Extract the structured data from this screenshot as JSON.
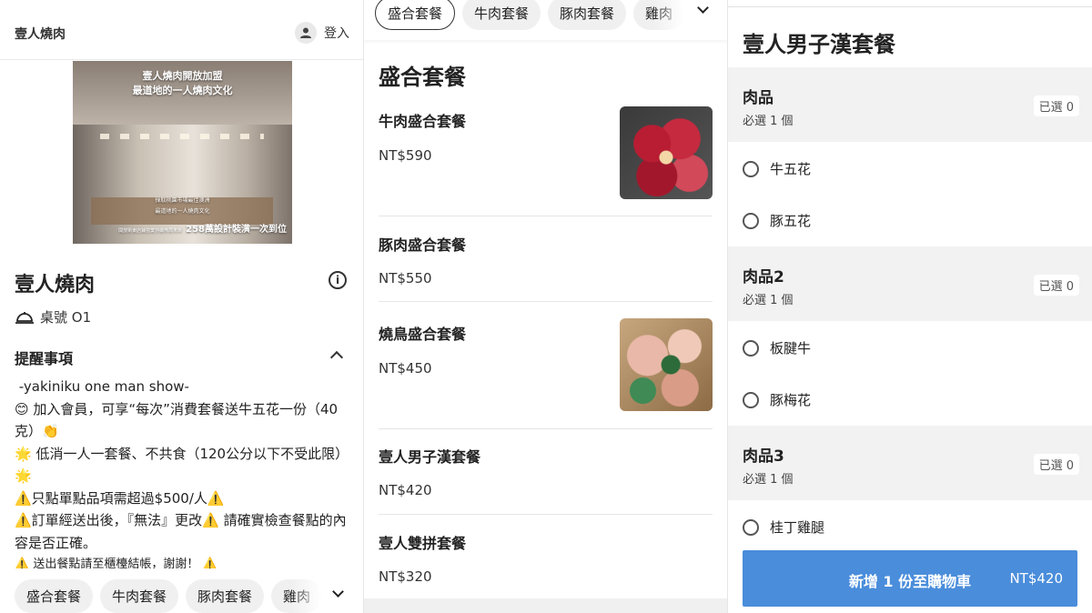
{
  "panel1": {
    "store_header": "壹人燒肉",
    "login_label": "登入",
    "banner": {
      "line1": "壹人燒肉開放加盟",
      "line2": "最道地的一人燒肉文化",
      "line3": "採取桃園市場最佳澳洲",
      "line4": "最道地的一人燒肉文化",
      "line5_small": "開放衛東店鋪營業持續佈局未來",
      "line5": "258萬設計裝潢一次到位"
    },
    "store_name": "壹人燒肉",
    "table_label": "桌號 O1",
    "notice_title": "提醒事項",
    "notice_lines": [
      " -yakiniku one man show-",
      "😊 加入會員，可享“每次”消費套餐送牛五花一份（40克）👏",
      "🌟 低消一人一套餐、不共食（120公分以下不受此限）🌟",
      "⚠️只點單點品項需超過$500/人⚠️",
      "⚠️訂單經送出後，『無法』更改⚠️ 請確實檢查餐點的內容是否正確。",
      "⚠️ 送出餐點請至櫃檯結帳，謝謝！ ⚠️"
    ],
    "categories": [
      "盛合套餐",
      "牛肉套餐",
      "豚肉套餐",
      "雞肉"
    ]
  },
  "panel2": {
    "categories": [
      "盛合套餐",
      "牛肉套餐",
      "豚肉套餐",
      "雞肉"
    ],
    "section_title": "盛合套餐",
    "items": [
      {
        "name": "牛肉盛合套餐",
        "price": "NT$590"
      },
      {
        "name": "豚肉盛合套餐",
        "price": "NT$550"
      },
      {
        "name": "燒鳥盛合套餐",
        "price": "NT$450"
      },
      {
        "name": "壹人男子漢套餐",
        "price": "NT$420"
      },
      {
        "name": "壹人雙拼套餐",
        "price": "NT$320"
      }
    ]
  },
  "panel3": {
    "title": "壹人男子漢套餐",
    "groups": [
      {
        "name": "肉品",
        "rule": "必選 1 個",
        "selected": "已選 0",
        "options": [
          "牛五花",
          "豚五花"
        ]
      },
      {
        "name": "肉品2",
        "rule": "必選 1 個",
        "selected": "已選 0",
        "options": [
          "板腱牛",
          "豚梅花"
        ]
      },
      {
        "name": "肉品3",
        "rule": "必選 1 個",
        "selected": "已選 0",
        "options": [
          "桂丁雞腿"
        ]
      }
    ],
    "cart_button_label": "新增 1 份至購物車",
    "cart_button_price": "NT$420"
  },
  "colors": {
    "accent_blue": "#4a8ddb",
    "chip_gray": "#f0f0f0",
    "group_gray": "#f2f2f2"
  },
  "icons": [
    "user-icon",
    "info-icon",
    "bell-tray-icon",
    "chevron-up-icon",
    "chevron-down-icon",
    "radio-icon"
  ]
}
